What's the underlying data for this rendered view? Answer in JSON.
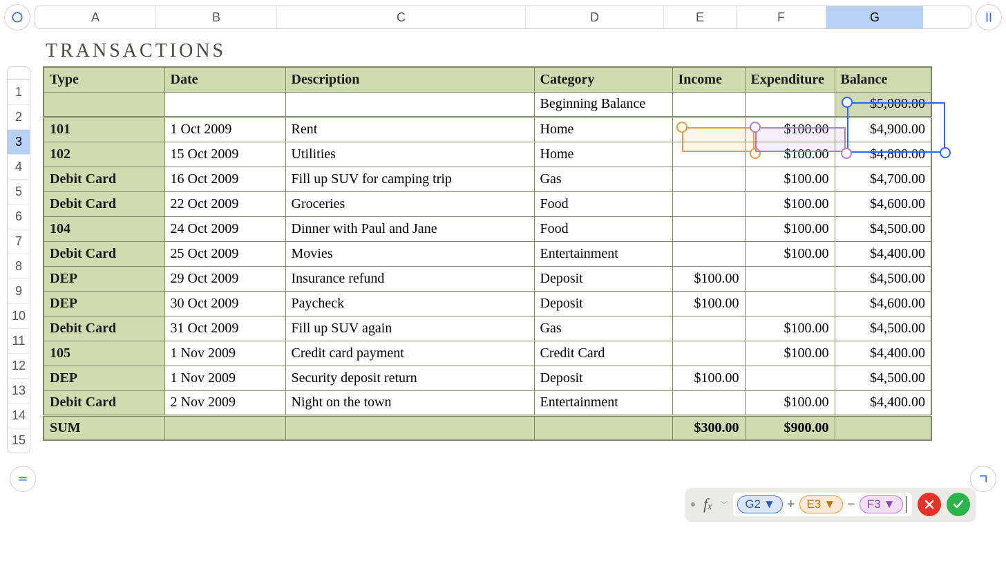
{
  "column_headers": [
    "A",
    "B",
    "C",
    "D",
    "E",
    "F",
    "G"
  ],
  "row_headers": [
    "1",
    "2",
    "3",
    "4",
    "5",
    "6",
    "7",
    "8",
    "9",
    "10",
    "11",
    "12",
    "13",
    "14",
    "15"
  ],
  "selected_column": "G",
  "selected_row": "3",
  "title": "TRANSACTIONS",
  "headers": {
    "type": "Type",
    "date": "Date",
    "description": "Description",
    "category": "Category",
    "income": "Income",
    "expenditure": "Expenditure",
    "balance": "Balance"
  },
  "beginning": {
    "label": "Beginning Balance",
    "balance": "$5,000.00"
  },
  "rows": [
    {
      "type": "101",
      "date": "1 Oct 2009",
      "desc": "Rent",
      "cat": "Home",
      "income": "",
      "exp": "$100.00",
      "bal": "$4,900.00"
    },
    {
      "type": "102",
      "date": "15 Oct 2009",
      "desc": "Utilities",
      "cat": "Home",
      "income": "",
      "exp": "$100.00",
      "bal": "$4,800.00"
    },
    {
      "type": "Debit Card",
      "date": "16 Oct 2009",
      "desc": "Fill up SUV for camping trip",
      "cat": "Gas",
      "income": "",
      "exp": "$100.00",
      "bal": "$4,700.00"
    },
    {
      "type": "Debit Card",
      "date": "22 Oct 2009",
      "desc": "Groceries",
      "cat": "Food",
      "income": "",
      "exp": "$100.00",
      "bal": "$4,600.00"
    },
    {
      "type": "104",
      "date": "24 Oct 2009",
      "desc": "Dinner with Paul and Jane",
      "cat": "Food",
      "income": "",
      "exp": "$100.00",
      "bal": "$4,500.00"
    },
    {
      "type": "Debit Card",
      "date": "25 Oct 2009",
      "desc": "Movies",
      "cat": "Entertainment",
      "income": "",
      "exp": "$100.00",
      "bal": "$4,400.00"
    },
    {
      "type": "DEP",
      "date": "29 Oct 2009",
      "desc": "Insurance refund",
      "cat": "Deposit",
      "income": "$100.00",
      "exp": "",
      "bal": "$4,500.00"
    },
    {
      "type": "DEP",
      "date": "30 Oct 2009",
      "desc": "Paycheck",
      "cat": "Deposit",
      "income": "$100.00",
      "exp": "",
      "bal": "$4,600.00"
    },
    {
      "type": "Debit Card",
      "date": "31 Oct 2009",
      "desc": "Fill up SUV again",
      "cat": "Gas",
      "income": "",
      "exp": "$100.00",
      "bal": "$4,500.00"
    },
    {
      "type": "105",
      "date": "1 Nov 2009",
      "desc": "Credit card payment",
      "cat": "Credit Card",
      "income": "",
      "exp": "$100.00",
      "bal": "$4,400.00"
    },
    {
      "type": "DEP",
      "date": "1 Nov 2009",
      "desc": "Security deposit return",
      "cat": "Deposit",
      "income": "$100.00",
      "exp": "",
      "bal": "$4,500.00"
    },
    {
      "type": "Debit Card",
      "date": "2 Nov 2009",
      "desc": "Night on the town",
      "cat": "Entertainment",
      "income": "",
      "exp": "$100.00",
      "bal": "$4,400.00"
    }
  ],
  "sum": {
    "label": "SUM",
    "income": "$300.00",
    "exp": "$900.00"
  },
  "formula": {
    "tokens": [
      {
        "ref": "G2",
        "kind": "g"
      },
      {
        "op": "+"
      },
      {
        "ref": "E3",
        "kind": "e"
      },
      {
        "op": "−"
      },
      {
        "ref": "F3",
        "kind": "f"
      }
    ]
  }
}
